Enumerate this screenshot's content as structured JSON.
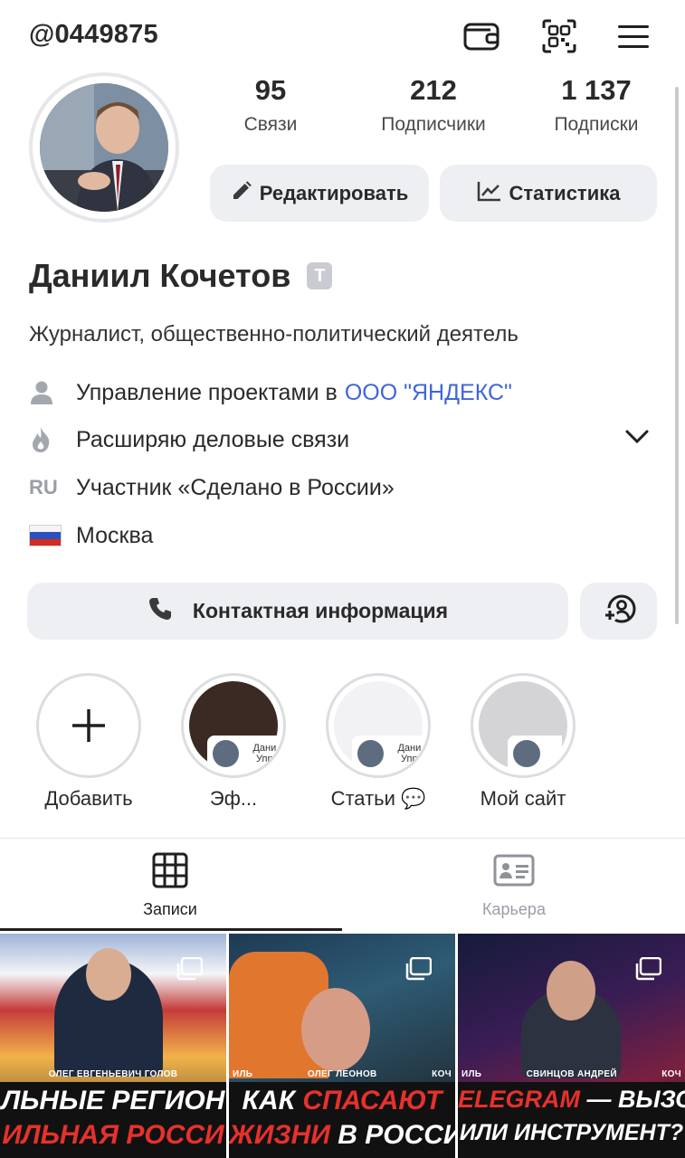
{
  "header": {
    "handle": "@0449875",
    "icons": [
      "wallet-icon",
      "qr-code-icon",
      "menu-icon"
    ]
  },
  "stats": [
    {
      "value": "95",
      "label": "Связи"
    },
    {
      "value": "212",
      "label": "Подписчики"
    },
    {
      "value": "1 137",
      "label": "Подписки"
    }
  ],
  "actions": {
    "edit_label": "Редактировать",
    "stats_label": "Статистика"
  },
  "profile": {
    "name": "Даниил Кочетов",
    "name_badge": "T",
    "bio": "Журналист, общественно-политический деятель",
    "details": {
      "work_prefix": "Управление проектами в",
      "work_company": "ООО \"ЯНДЕКС\"",
      "goal": "Расширяю деловые связи",
      "membership_icon_text": "RU",
      "membership": "Участник «Сделано в России»",
      "city": "Москва"
    }
  },
  "contact": {
    "label": "Контактная информация"
  },
  "highlights": {
    "items": [
      {
        "label": "Добавить"
      },
      {
        "label": "Эф...",
        "mini_text": "Дани Упр"
      },
      {
        "label": "Статьи 💬",
        "mini_text": "Дани Упр"
      },
      {
        "label": "Мой сайт"
      }
    ]
  },
  "tabs": [
    {
      "label": "Записи",
      "active": true
    },
    {
      "label": "Карьера",
      "active": false
    }
  ],
  "posts": [
    {
      "person": "ОЛЕГ ЕВГЕНЬЕВИЧ ГОЛОВ",
      "line1": "ЛЬНЫЕ РЕГИОН",
      "line2": "ИЛЬНАЯ РОССИ"
    },
    {
      "person_left": "ИЛЬ",
      "person": "ОЛЕГ ЛЕОНОВ",
      "person_right": "КОЧ",
      "line1_a": "КАК ",
      "line1_b": "СПАСАЮТ",
      "line2_a": "ЖИЗНИ ",
      "line2_b": "В РОССИИ"
    },
    {
      "person_left": "ИЛЬ",
      "person": "СВИНЦОВ АНДРЕЙ",
      "person_right": "КОЧ",
      "line1_a": "ELEGRAM",
      "line1_b": " — ВЫЗО",
      "line2": "ИЛИ ИНСТРУМЕНТ?"
    }
  ],
  "colors": {
    "accent_link": "#3f66d6",
    "button_bg": "#eeeff2",
    "text": "#2a2a2a",
    "muted": "#9a9ea6",
    "headline_red": "#e6312c"
  }
}
